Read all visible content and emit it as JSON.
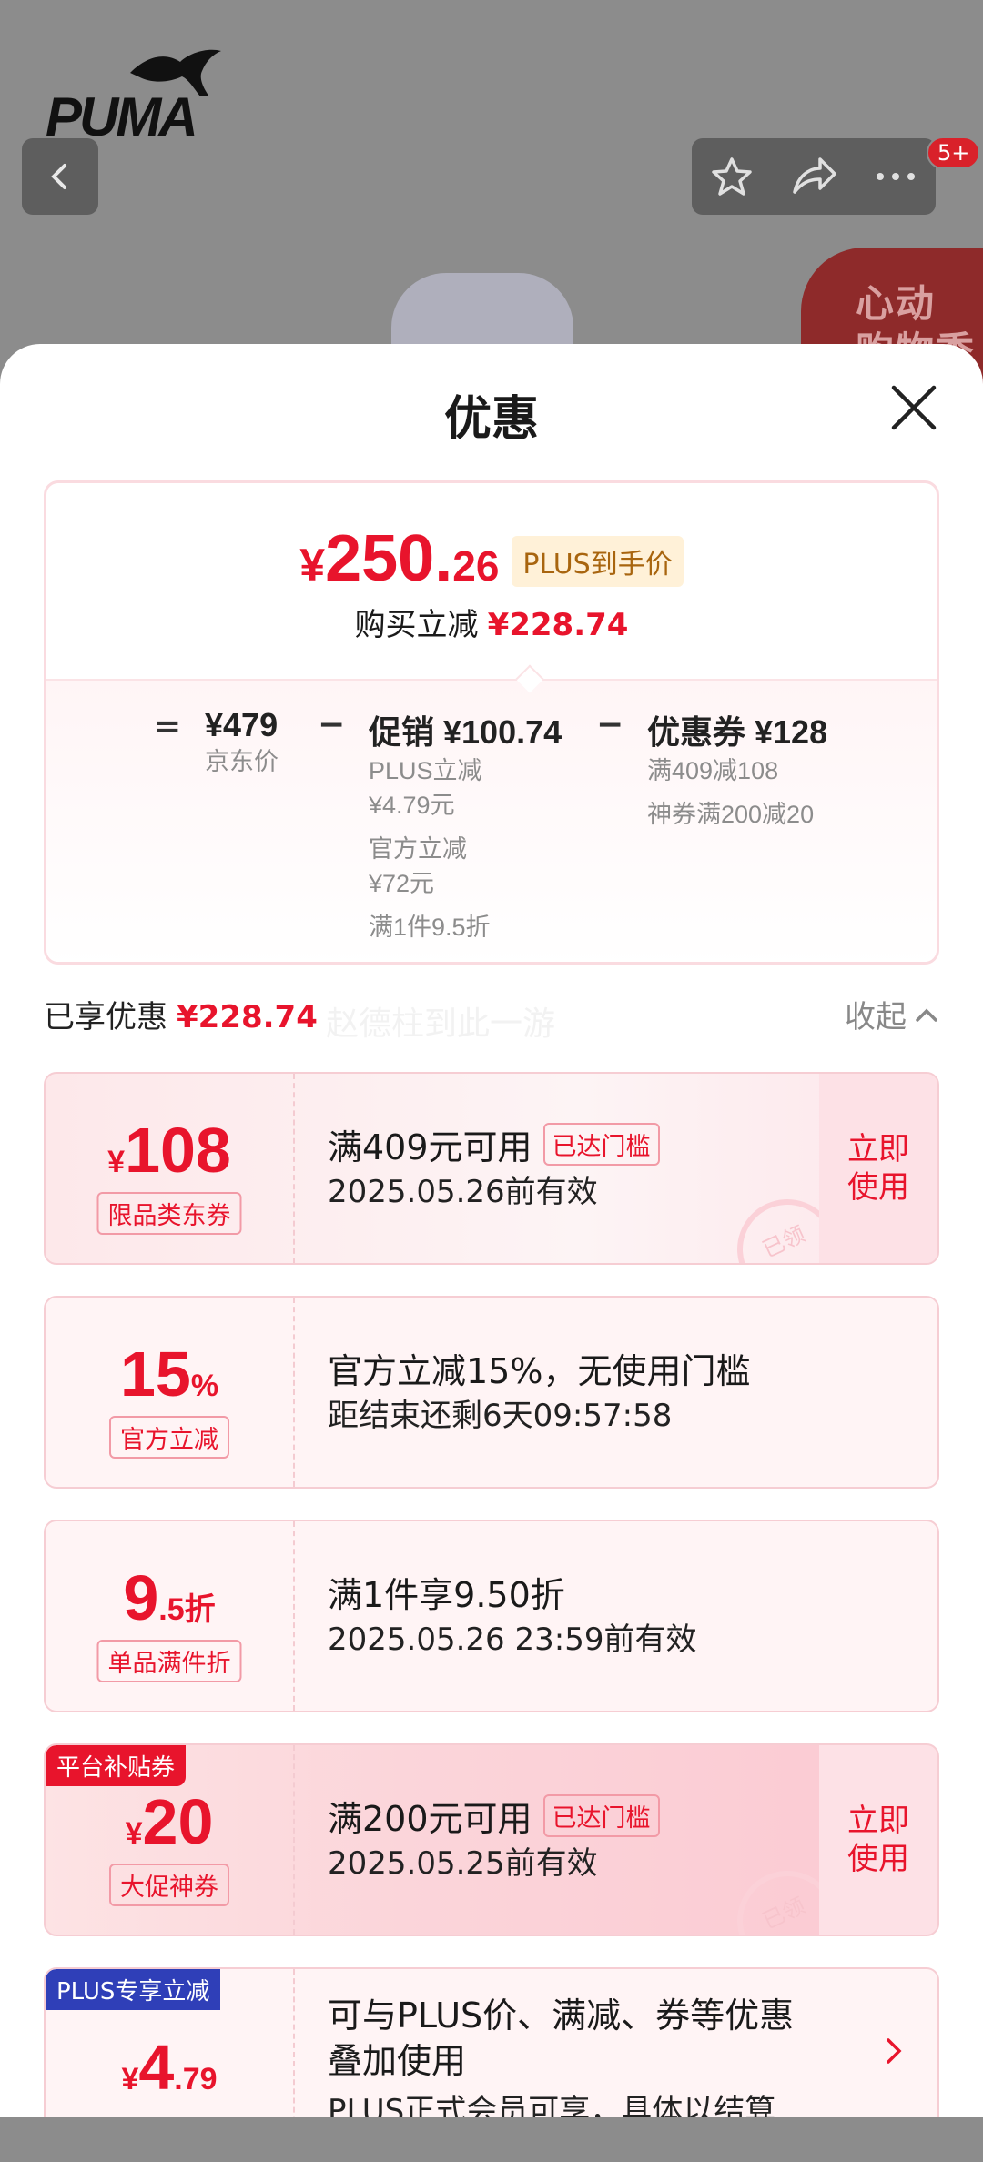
{
  "background": {
    "brand": "PUMA",
    "badge_count": "5+",
    "promo_text_line1": "心动",
    "promo_text_line2": "购物季"
  },
  "sheet": {
    "title": "优惠"
  },
  "summary": {
    "price_currency": "¥",
    "price_int": "250.",
    "price_dec": "26",
    "price_tag": "PLUS到手价",
    "reduce_label": "购买立减",
    "reduce_amount": "¥228.74",
    "eq": "=",
    "minus": "−",
    "jd_price": "¥479",
    "jd_label": "京东价",
    "promo_main": "促销 ¥100.74",
    "promo_items": [
      "PLUS立减",
      "¥4.79元",
      "官方立减",
      "¥72元",
      "满1件9.5折"
    ],
    "coupon_main": "优惠券 ¥128",
    "coupon_items": [
      "满409减108",
      "神券满200减20"
    ]
  },
  "enjoyed": {
    "label": "已享优惠",
    "amount": "¥228.74",
    "watermark": "赵德柱到此一游",
    "collapse": "收起"
  },
  "coupons": [
    {
      "cur": "¥",
      "amount": "108",
      "tag": "限品类东券",
      "main": "满409元可用",
      "chip": "已达门槛",
      "sub": "2025.05.26前有效",
      "use": "立即使用",
      "stamp": "已领"
    },
    {
      "amount": "15",
      "suffix": "%",
      "tag": "官方立减",
      "main": "官方立减15%，无使用门槛",
      "sub": "距结束还剩6天09:57:58"
    },
    {
      "amount": "9",
      "suffix": ".5折",
      "tag": "单品满件折",
      "main": "满1件享9.50折",
      "sub": "2025.05.26 23:59前有效"
    },
    {
      "corner": "平台补贴券",
      "cur": "¥",
      "amount": "20",
      "tag": "大促神券",
      "main": "满200元可用",
      "chip": "已达门槛",
      "sub": "2025.05.25前有效",
      "use": "立即使用",
      "stamp": "已领"
    },
    {
      "corner": "PLUS专享立减",
      "cur": "¥",
      "amount": "4",
      "suffix": ".79",
      "main_line1": "可与PLUS价、满减、券等优惠",
      "main_line2": "叠加使用",
      "sub": "PLUS正式会员可享，具体以结算..."
    }
  ],
  "colors": {
    "accent_red": "#e8142c",
    "plus_blue": "#2f3fb8",
    "platform_red": "#e8142c"
  }
}
